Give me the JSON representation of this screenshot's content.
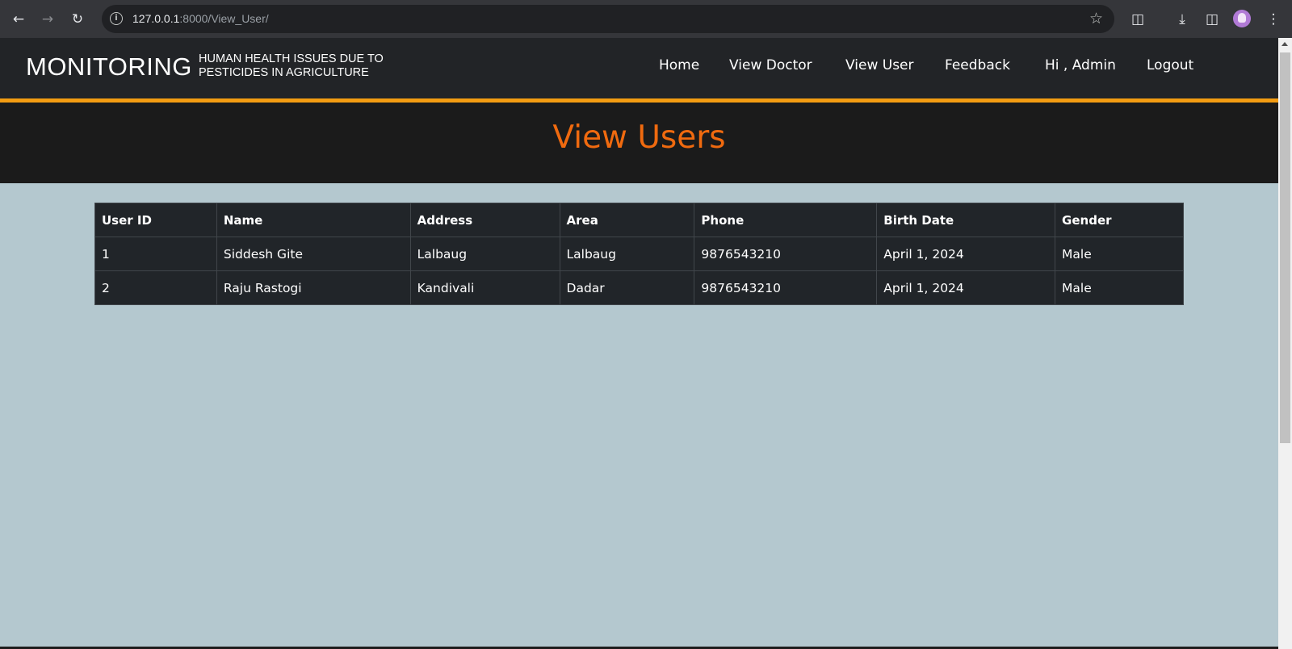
{
  "browser": {
    "url_host": "127.0.0.1",
    "url_rest": ":8000/View_User/"
  },
  "site": {
    "brand": "MONITORING",
    "tagline_line1": "HUMAN HEALTH ISSUES DUE TO",
    "tagline_line2": "PESTICIDES IN AGRICULTURE",
    "nav": {
      "home": "Home",
      "view_doctor": "View Doctor",
      "view_user": "View User",
      "feedback": "Feedback",
      "greeting": "Hi , Admin",
      "logout": "Logout"
    },
    "accent_color": "#f39c12",
    "title_color": "#f06a0f"
  },
  "page": {
    "title": "View Users"
  },
  "table": {
    "headers": [
      "User ID",
      "Name",
      "Address",
      "Area",
      "Phone",
      "Birth Date",
      "Gender"
    ],
    "rows": [
      [
        "1",
        "Siddesh Gite",
        "Lalbaug",
        "Lalbaug",
        "9876543210",
        "April 1, 2024",
        "Male"
      ],
      [
        "2",
        "Raju Rastogi",
        "Kandivali",
        "Dadar",
        "9876543210",
        "April 1, 2024",
        "Male"
      ]
    ]
  },
  "icons": [
    "back-arrow-icon",
    "forward-arrow-icon",
    "reload-icon",
    "site-info-icon",
    "bookmark-star-icon",
    "extensions-icon",
    "download-icon",
    "side-panel-icon",
    "profile-avatar-icon",
    "menu-dots-icon"
  ]
}
